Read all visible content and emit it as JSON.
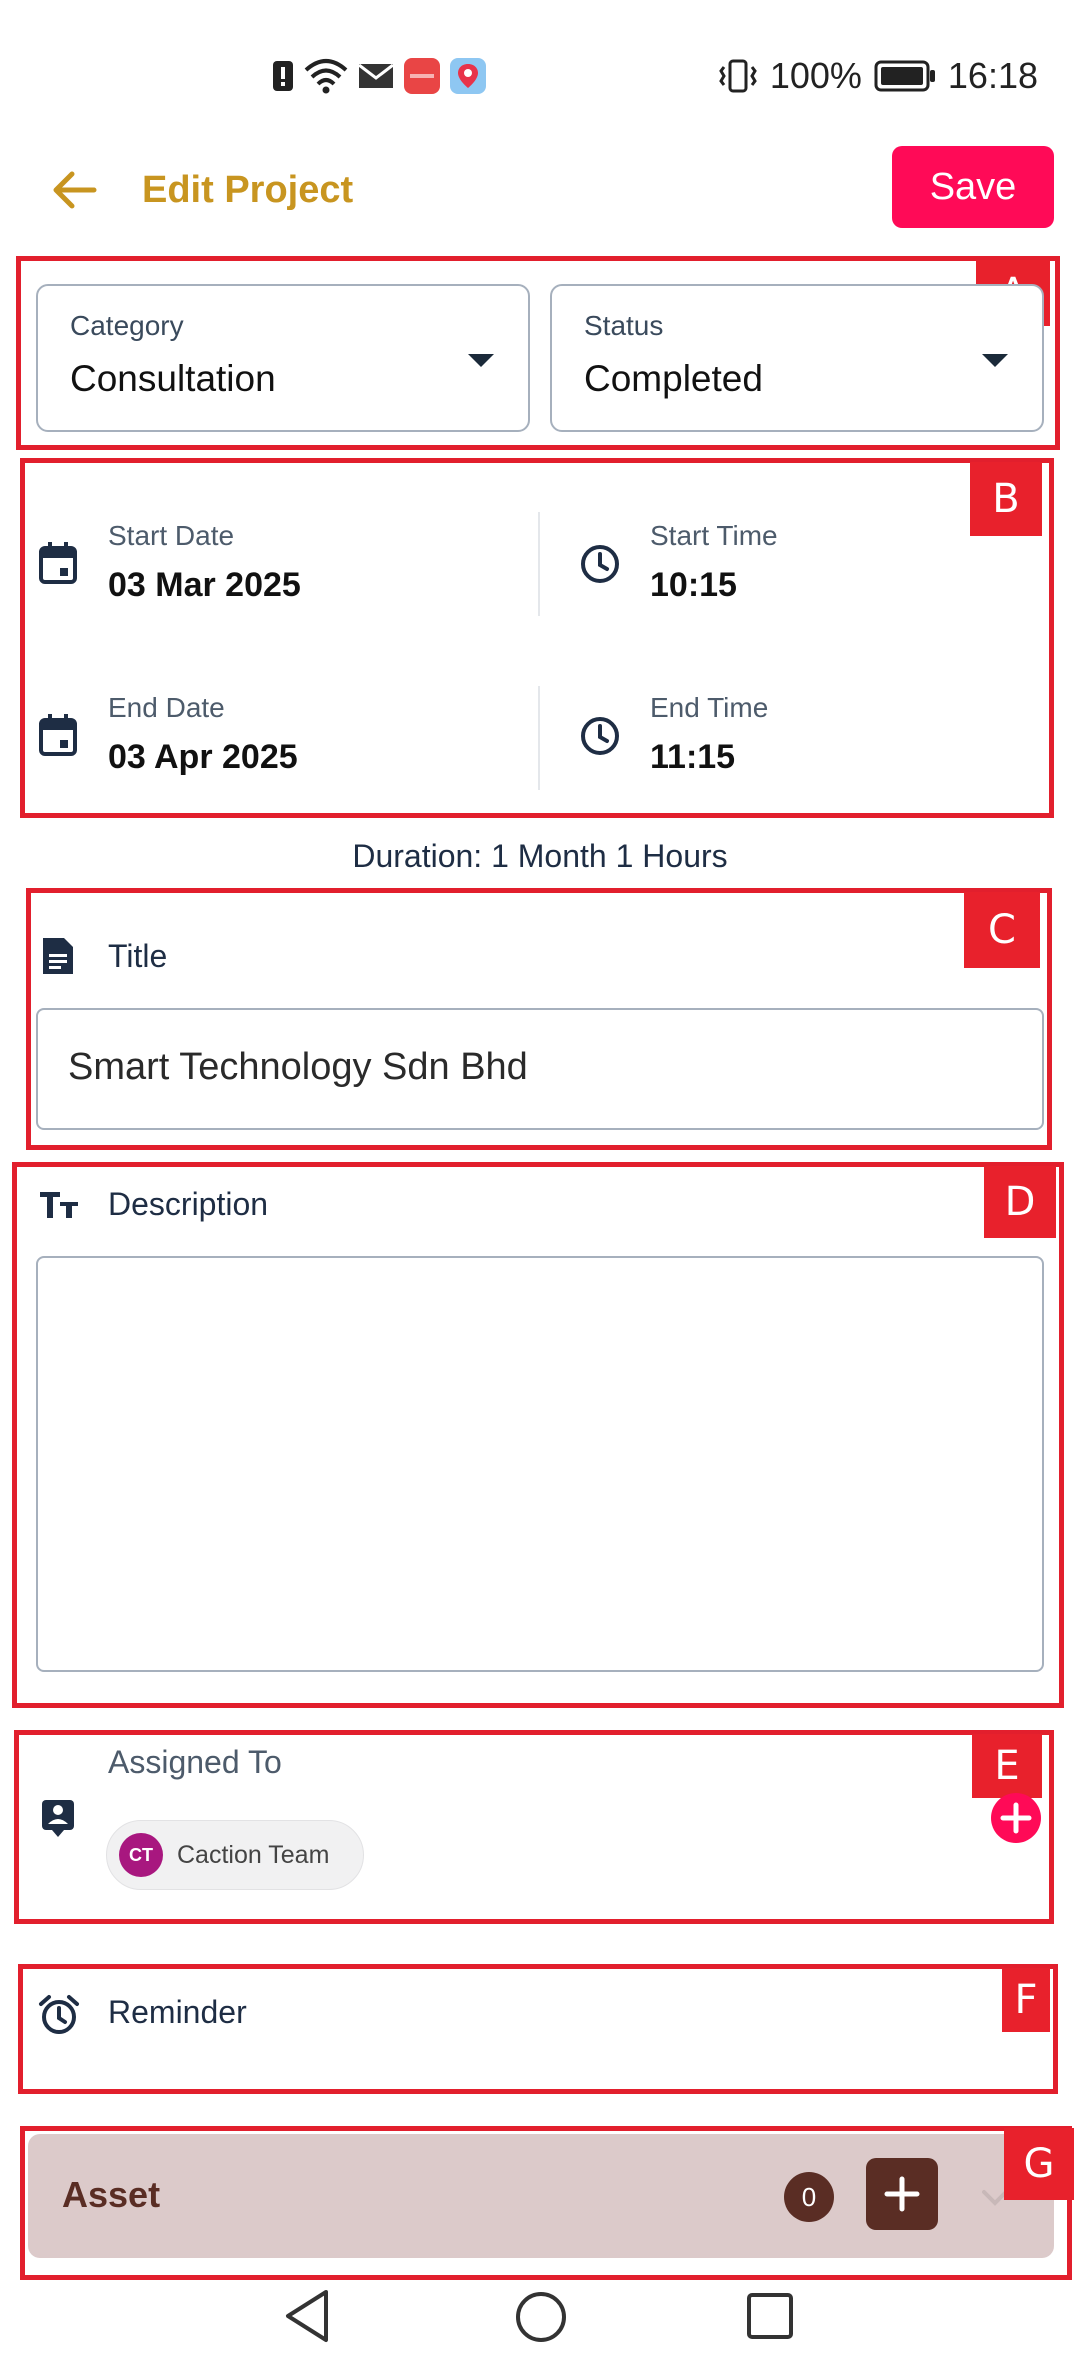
{
  "status_bar": {
    "battery": "100%",
    "time": "16:18",
    "icons": [
      "alert-icon",
      "wifi-icon",
      "mail-icon",
      "huawei-app-icon",
      "maps-app-icon",
      "vibrate-icon",
      "battery-icon"
    ]
  },
  "header": {
    "title": "Edit Project",
    "save_label": "Save"
  },
  "annotations": {
    "A": "A",
    "B": "B",
    "C": "C",
    "D": "D",
    "E": "E",
    "F": "F",
    "G": "G"
  },
  "category": {
    "label": "Category",
    "value": "Consultation"
  },
  "status": {
    "label": "Status",
    "value": "Completed"
  },
  "dates": {
    "start_date_label": "Start Date",
    "start_date": "03 Mar 2025",
    "start_time_label": "Start Time",
    "start_time": "10:15",
    "end_date_label": "End Date",
    "end_date": "03 Apr 2025",
    "end_time_label": "End Time",
    "end_time": "11:15"
  },
  "duration": "Duration: 1 Month 1 Hours",
  "title_field": {
    "label": "Title",
    "value": "Smart Technology Sdn Bhd"
  },
  "description": {
    "label": "Description",
    "value": ""
  },
  "assigned": {
    "label": "Assigned To",
    "chips": [
      {
        "initials": "CT",
        "name": "Caction Team"
      }
    ]
  },
  "reminder": {
    "label": "Reminder"
  },
  "asset": {
    "label": "Asset",
    "count": "0"
  },
  "colors": {
    "accent": "#ff0a57",
    "title_gold": "#c89520",
    "annotation_red": "#e21f2d",
    "asset_bg": "#dccaca",
    "asset_dark": "#5a2d24",
    "avatar": "#a8177f"
  }
}
